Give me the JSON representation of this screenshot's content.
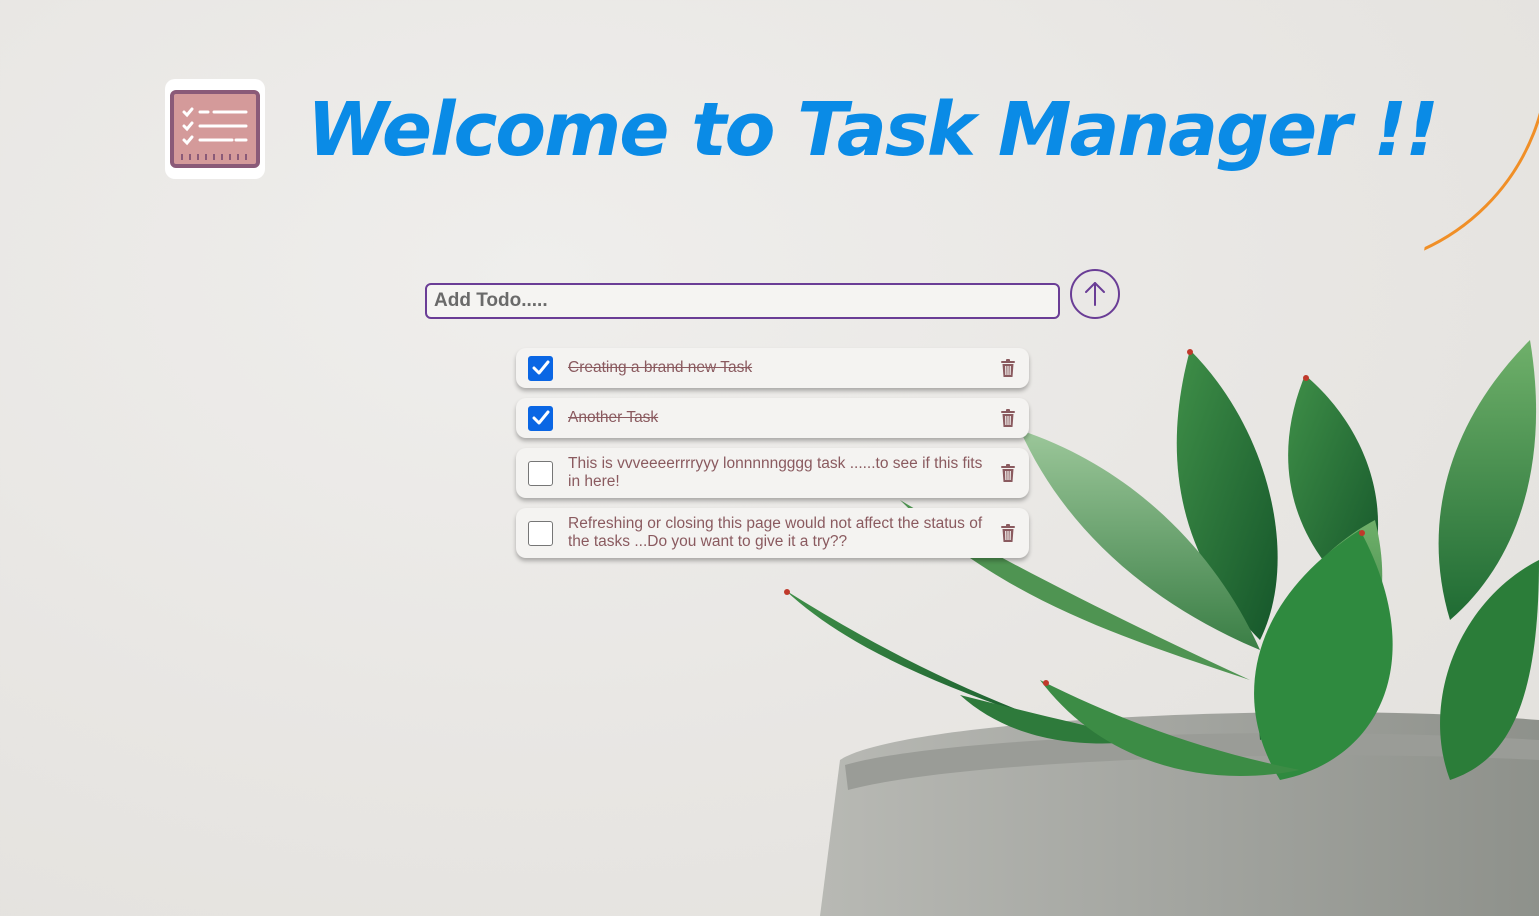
{
  "colors": {
    "title": "#0a8be6",
    "accent_purple": "#6a3d96",
    "checkbox_checked": "#0a66e4",
    "todo_text": "#8a5a5f",
    "delete_icon": "#8a5a5f",
    "logo_bg": "#d49a9a",
    "orange_arc": "#f08a1c"
  },
  "header": {
    "logo_icon": "task-list-icon",
    "title": "Welcome to Task Manager !!"
  },
  "add_todo": {
    "placeholder": "Add Todo.....",
    "value": "",
    "submit_icon": "arrow-up-icon"
  },
  "todos": [
    {
      "text": "Creating a brand new Task",
      "completed": true
    },
    {
      "text": "Another Task",
      "completed": true
    },
    {
      "text": "This is vvveeeerrrryyy lonnnnngggg task ......to see if this fits in here!",
      "completed": false
    },
    {
      "text": "Refreshing or closing this page would not affect the status of the tasks ...Do you want to give it a try??",
      "completed": false
    }
  ]
}
